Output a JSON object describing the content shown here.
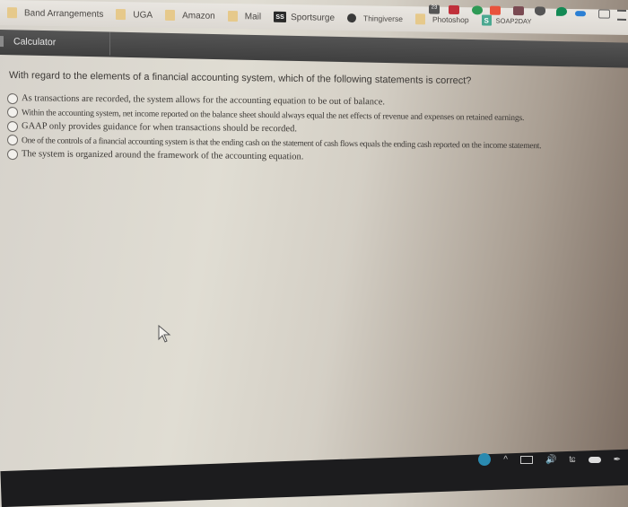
{
  "bookmarks": [
    {
      "label": "Band Arrangements",
      "icon": "folder-icon"
    },
    {
      "label": "UGA",
      "icon": "folder-icon"
    },
    {
      "label": "Amazon",
      "icon": "folder-icon"
    },
    {
      "label": "Mail",
      "icon": "folder-icon"
    },
    {
      "label": "Sportsurge",
      "icon": "ss-icon",
      "icon_text": "SS"
    },
    {
      "label": "Thingiverse",
      "icon": "globe-icon"
    },
    {
      "label": "Photoshop",
      "icon": "folder-icon"
    },
    {
      "label": "SOAP2DAY",
      "icon": "s-icon",
      "icon_text": "S"
    }
  ],
  "extension_badge": "23",
  "toolbar": {
    "calculator_label": "Calculator"
  },
  "question": {
    "text": "With regard to the elements of a financial accounting system, which of the following statements is correct?",
    "options": [
      "As transactions are recorded, the system allows for the accounting equation to be out of balance.",
      "Within the accounting system, net income reported on the balance sheet should always equal the net effects of revenue and expenses on retained earnings.",
      "GAAP only provides guidance for when transactions should be recorded.",
      "One of the controls of a financial accounting system is that the ending cash on the statement of cash flows equals the ending cash reported on the income statement.",
      "The system is organized around the framework of the accounting equation."
    ]
  },
  "colors": {
    "toolbar_bg": "#484848",
    "folder_icon": "#e6c98b",
    "soap2day_icon": "#4aa890",
    "taskbar_bg": "#1c1c1e"
  }
}
